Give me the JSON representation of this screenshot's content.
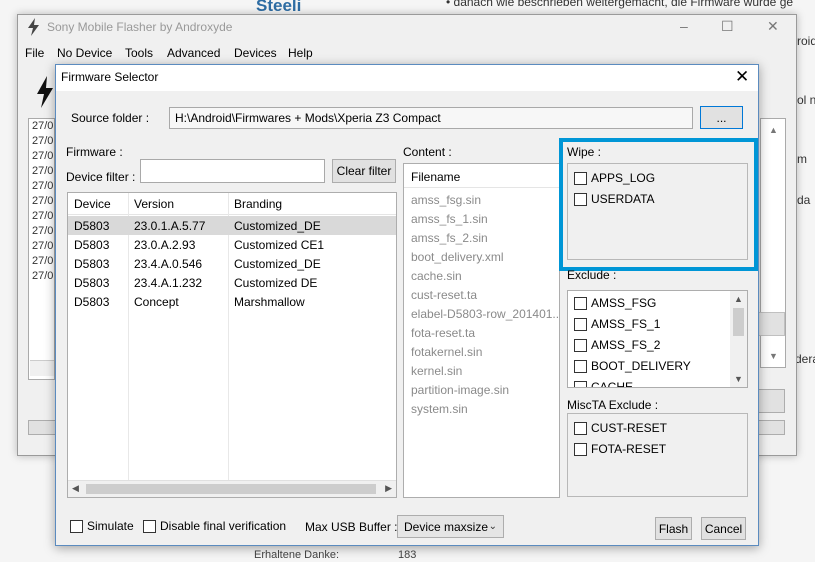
{
  "background": {
    "site_title": "Steeli",
    "line_1": "• danach wie beschrieben weitergemacht, die Firmware wurde ge",
    "fragment_1": "roid",
    "fragment_2": "ol n",
    "fragment_3": "m",
    "fragment_4": "da",
    "fragment_5": "dera",
    "thanks_label": "Erhaltene Danke:",
    "thanks_count": "183"
  },
  "main_window": {
    "title": "Sony Mobile Flasher by Androxyde",
    "menu": [
      "File",
      "No Device",
      "Tools",
      "Advanced",
      "Devices",
      "Help"
    ],
    "log_lines": [
      "27/0",
      "27/0",
      "27/0",
      "27/0",
      "27/0",
      "27/0",
      "27/0",
      "27/0",
      "27/0",
      "27/0",
      "27/0"
    ]
  },
  "dialog": {
    "title": "Firmware Selector",
    "close_glyph": "✕",
    "source_folder_label": "Source folder :",
    "source_folder_value": "H:\\Android\\Firmwares + Mods\\Xperia Z3 Compact",
    "browse_label": "...",
    "firmware_label": "Firmware :",
    "device_filter_label": "Device filter :",
    "device_filter_value": "",
    "clear_filter_label": "Clear filter",
    "columns": [
      "Device",
      "Version",
      "Branding"
    ],
    "rows": [
      {
        "device": "D5803",
        "version": "23.0.1.A.5.77",
        "branding": "Customized_DE"
      },
      {
        "device": "D5803",
        "version": "23.0.A.2.93",
        "branding": "Customized CE1"
      },
      {
        "device": "D5803",
        "version": "23.4.A.0.546",
        "branding": "Customized_DE"
      },
      {
        "device": "D5803",
        "version": "23.4.A.1.232",
        "branding": "Customized DE"
      },
      {
        "device": "D5803",
        "version": "Concept",
        "branding": "Marshmallow"
      }
    ],
    "content_label": "Content :",
    "content_header": "Filename",
    "content_items": [
      "amss_fsg.sin",
      "amss_fs_1.sin",
      "amss_fs_2.sin",
      "boot_delivery.xml",
      "cache.sin",
      "cust-reset.ta",
      "elabel-D5803-row_201401...",
      "fota-reset.ta",
      "fotakernel.sin",
      "kernel.sin",
      "partition-image.sin",
      "system.sin"
    ],
    "wipe_label": "Wipe :",
    "wipe_items": [
      "APPS_LOG",
      "USERDATA"
    ],
    "exclude_label": "Exclude :",
    "exclude_items": [
      "AMSS_FSG",
      "AMSS_FS_1",
      "AMSS_FS_2",
      "BOOT_DELIVERY",
      "CACHE"
    ],
    "miscta_label": "MiscTA Exclude :",
    "miscta_items": [
      "CUST-RESET",
      "FOTA-RESET"
    ],
    "simulate_label": "Simulate",
    "disable_verification_label": "Disable final verification",
    "max_usb_label": "Max USB Buffer :",
    "max_usb_value": "Device maxsize",
    "flash_label": "Flash",
    "cancel_label": "Cancel"
  },
  "colors": {
    "highlight": "#0096d6",
    "selected_row": "#d9d9d9",
    "dialog_bg": "#f0f0f0"
  }
}
